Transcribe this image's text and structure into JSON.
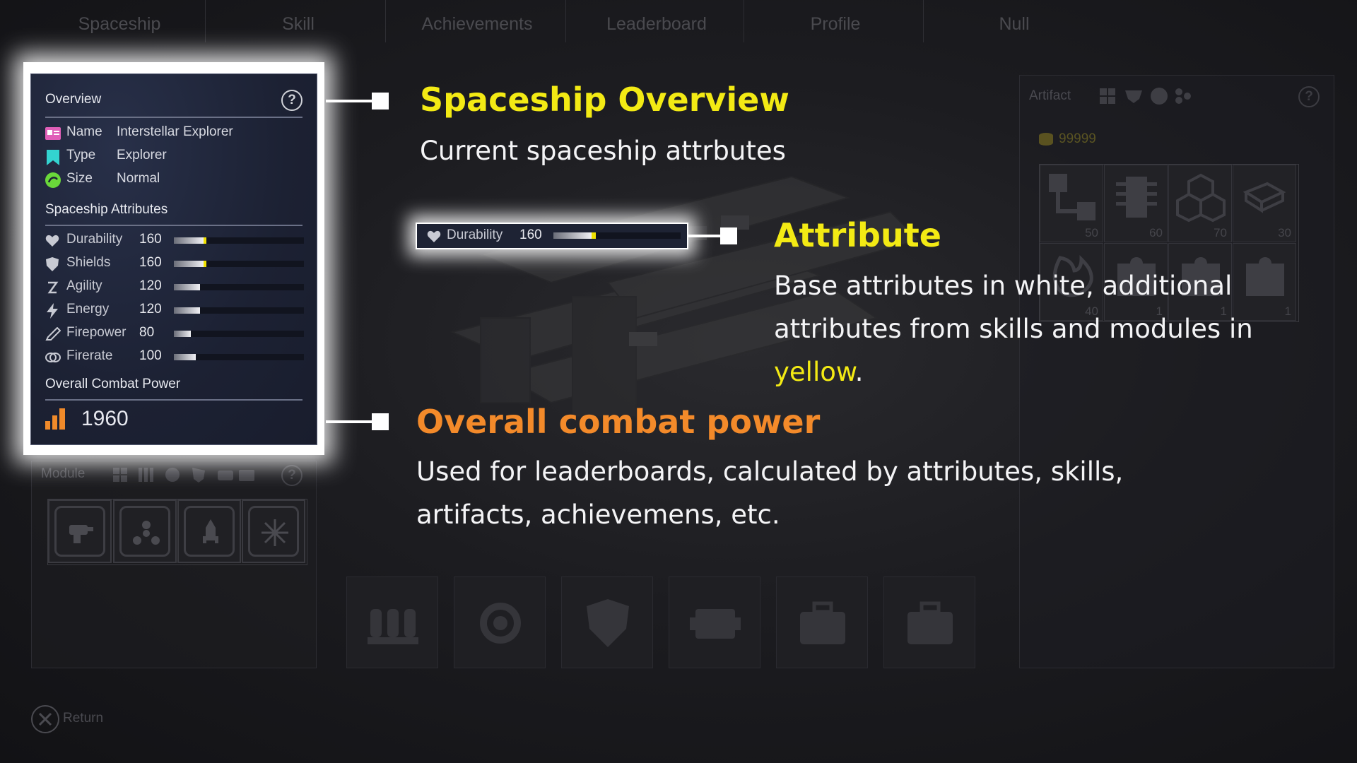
{
  "nav": {
    "tabs": [
      "Spaceship",
      "Skill",
      "Achievements",
      "Leaderboard",
      "Profile",
      "Null"
    ]
  },
  "overview": {
    "title": "Overview",
    "help": "?",
    "info": [
      {
        "label": "Name",
        "value": "Interstellar Explorer",
        "icon": "id-card-icon",
        "color": "#e05fb8"
      },
      {
        "label": "Type",
        "value": "Explorer",
        "icon": "bookmark-icon",
        "color": "#33d3d0"
      },
      {
        "label": "Size",
        "value": "Normal",
        "icon": "size-icon",
        "color": "#6ad83a"
      }
    ],
    "attributes_title": "Spaceship Attributes",
    "attributes": [
      {
        "label": "Durability",
        "value": "160",
        "icon": "heart-icon",
        "base_pct": 0.23,
        "add_pct": 0.02
      },
      {
        "label": "Shields",
        "value": "160",
        "icon": "shield-icon",
        "base_pct": 0.23,
        "add_pct": 0.02
      },
      {
        "label": "Agility",
        "value": "120",
        "icon": "agility-icon",
        "base_pct": 0.2,
        "add_pct": 0
      },
      {
        "label": "Energy",
        "value": "120",
        "icon": "lightning-icon",
        "base_pct": 0.2,
        "add_pct": 0
      },
      {
        "label": "Firepower",
        "value": "80",
        "icon": "firepower-icon",
        "base_pct": 0.13,
        "add_pct": 0
      },
      {
        "label": "Firerate",
        "value": "100",
        "icon": "firerate-icon",
        "base_pct": 0.17,
        "add_pct": 0
      }
    ],
    "combat_title": "Overall Combat Power",
    "combat_value": "1960"
  },
  "module": {
    "title": "Module",
    "help": "?"
  },
  "artifact": {
    "title": "Artifact",
    "help": "?",
    "currency": "99999",
    "cells": [
      "50",
      "60",
      "70",
      "30",
      "40",
      "1",
      "1",
      "1"
    ]
  },
  "highlight": {
    "label": "Durability",
    "value": "160"
  },
  "annotations": {
    "overview_title": "Spaceship Overview",
    "overview_desc": "Current spaceship attrbutes",
    "attribute_title": "Attribute",
    "attribute_desc_1": "Base attributes in white, additional",
    "attribute_desc_2": "attributes from skills and modules in",
    "attribute_desc_yellow": "yellow",
    "attribute_desc_end": ".",
    "combat_title": "Overall combat power",
    "combat_desc_1": "Used for leaderboards, calculated by attributes, skills,",
    "combat_desc_2": "artifacts, achievemens, etc."
  },
  "return_label": "Return",
  "colors": {
    "highlight_yellow": "#f3ea14",
    "highlight_orange": "#f38a2a",
    "panel_bg": "#1d2236"
  }
}
